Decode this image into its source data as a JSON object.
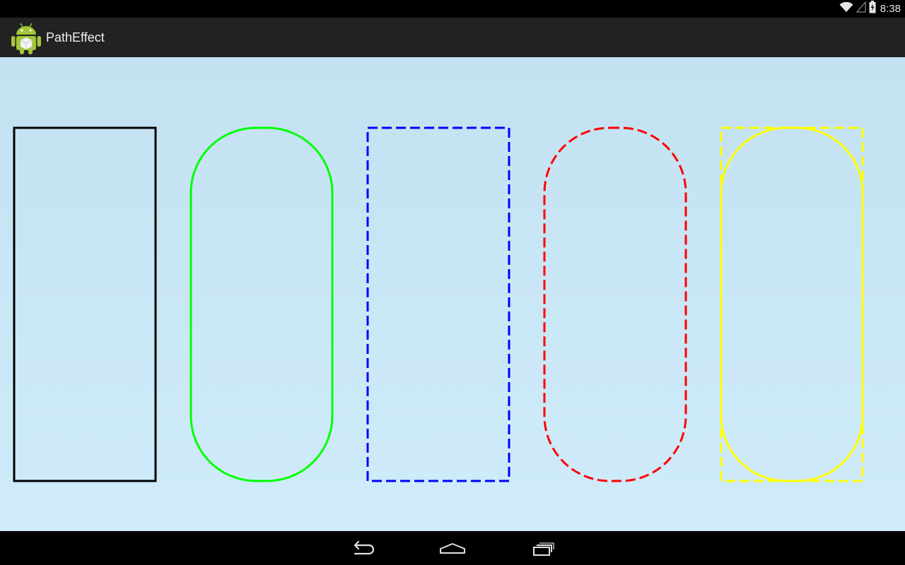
{
  "status_bar": {
    "time": "8:38",
    "icons": [
      "wifi-icon",
      "signal-icon",
      "battery-icon"
    ]
  },
  "action_bar": {
    "title": "PathEffect",
    "icon": "android-robot-icon"
  },
  "content": {
    "background": "#c8e6f6",
    "shapes": [
      {
        "name": "rectangle-plain",
        "color": "#000000",
        "effect": "none",
        "shape": "rect"
      },
      {
        "name": "rounded-rect-corner-effect",
        "color": "#00ff00",
        "effect": "corner",
        "shape": "rounded"
      },
      {
        "name": "rectangle-dash-effect",
        "color": "#0000ff",
        "effect": "dash",
        "shape": "rect"
      },
      {
        "name": "rounded-rect-compose-effect",
        "color": "#ff0000",
        "effect": "dash-corner",
        "shape": "rounded"
      },
      {
        "name": "rect-sum-effect",
        "color": "#ffff00",
        "effect": "sum",
        "shape": "both"
      }
    ]
  },
  "nav_bar": {
    "buttons": [
      "back-icon",
      "home-icon",
      "recents-icon"
    ]
  }
}
